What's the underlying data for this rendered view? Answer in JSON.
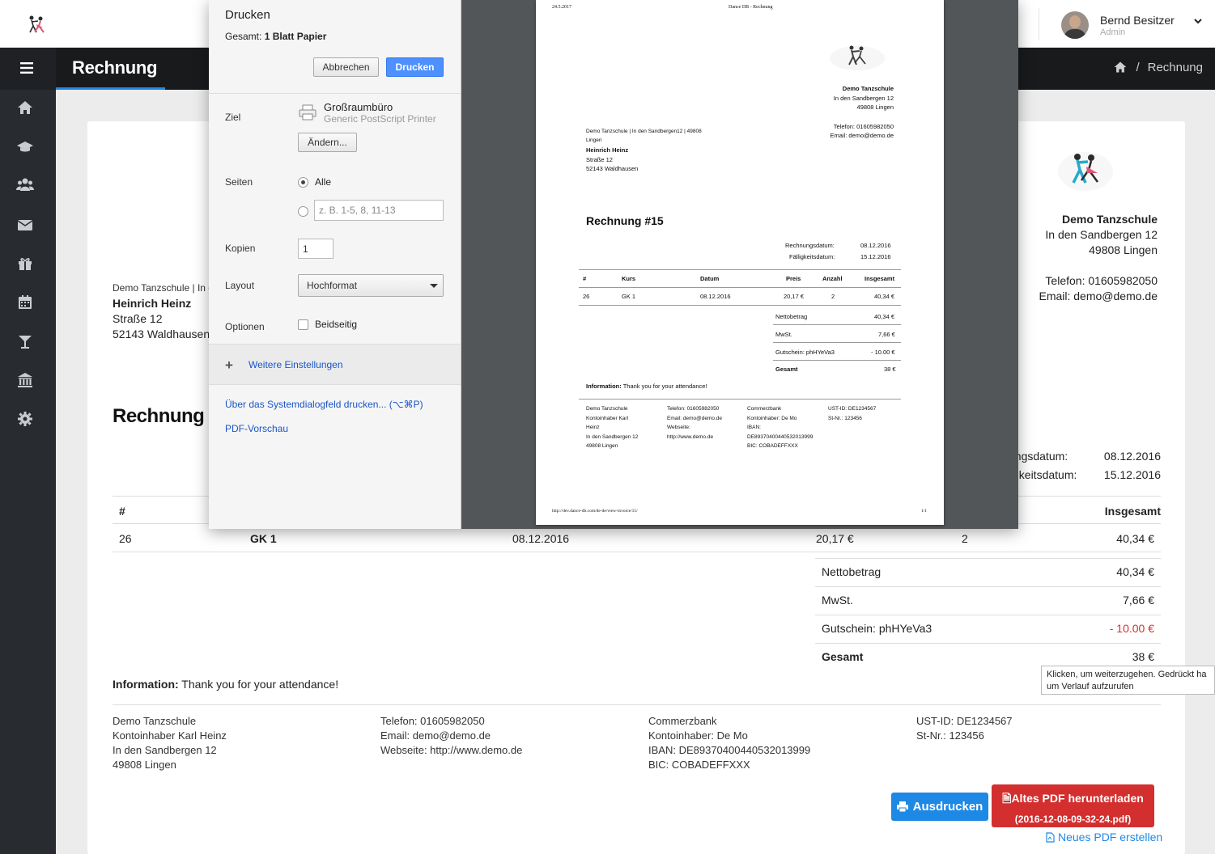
{
  "topbar": {
    "user_name": "Bernd Besitzer",
    "user_role": "Admin"
  },
  "header": {
    "title": "Rechnung",
    "breadcrumb": "Rechnung"
  },
  "sidebar": {
    "items": [
      "home-icon",
      "graduation-cap-icon",
      "users-icon",
      "envelope-icon",
      "gift-icon",
      "calendar-icon",
      "cocktail-icon",
      "bank-icon",
      "gear-icon"
    ]
  },
  "invoice": {
    "company": {
      "name": "Demo Tanzschule",
      "street": "In den Sandbergen 12",
      "city": "49808 Lingen",
      "phone": "Telefon: 01605982050",
      "email": "Email: demo@demo.de"
    },
    "sender_line": "Demo Tanzschule | In d",
    "recipient": {
      "name": "Heinrich Heinz",
      "street": "Straße 12",
      "city": "52143 Waldhausen"
    },
    "title": "Rechnung #",
    "invoice_date_label": "ungsdatum:",
    "invoice_date": "08.12.2016",
    "due_date_label": "gkeitsdatum:",
    "due_date": "15.12.2016",
    "table": {
      "col_num": "#",
      "col_total": "Insgesamt",
      "row": {
        "num": "26",
        "course": "GK 1",
        "date": "08.12.2016",
        "price": "20,17 €",
        "qty": "2",
        "total": "40,34 €"
      }
    },
    "summary": {
      "net_label": "Nettobetrag",
      "net": "40,34 €",
      "tax_label": "MwSt.",
      "tax": "7,66 €",
      "voucher_label": "Gutschein: phHYeVa3",
      "voucher": "- 10.00 €",
      "total_label": "Gesamt",
      "total": "38 €"
    },
    "info_label": "Information:",
    "info_text": " Thank you for your attendance!",
    "footer": {
      "col1": [
        "Demo Tanzschule",
        "Kontoinhaber Karl Heinz",
        "In den Sandbergen 12",
        "49808 Lingen"
      ],
      "col2": [
        "Telefon: 01605982050",
        "Email: demo@demo.de",
        "Webseite: http://www.demo.de"
      ],
      "col3": [
        "Commerzbank",
        "Kontoinhaber: De Mo",
        "IBAN: DE89370400440532013999",
        "BIC: COBADEFFXXX"
      ],
      "col4": [
        "UST-ID: DE1234567",
        "St-Nr.: 123456"
      ]
    },
    "print_button": "Ausdrucken",
    "old_pdf_button": "Altes PDF herunterladen",
    "old_pdf_file": "(2016-12-08-09-32-24.pdf)",
    "new_pdf_link": "Neues PDF erstellen"
  },
  "tooltip": {
    "line1": "Klicken, um weiterzugehen. Gedrückt ha",
    "line2": "um Verlauf aufzurufen"
  },
  "print_dialog": {
    "title": "Drucken",
    "total_label": "Gesamt: ",
    "total_value": "1 Blatt Papier",
    "cancel": "Abbrechen",
    "print": "Drucken",
    "dest_label": "Ziel",
    "printer_name": "Großraumbüro",
    "printer_type": "Generic PostScript Printer",
    "change": "Ändern...",
    "pages_label": "Seiten",
    "pages_all": "Alle",
    "pages_placeholder": "z. B. 1-5, 8, 11-13",
    "copies_label": "Kopien",
    "copies_value": "1",
    "layout_label": "Layout",
    "layout_value": "Hochformat",
    "options_label": "Optionen",
    "duplex": "Beidseitig",
    "more_settings": "Weitere Einstellungen",
    "system_dialog": "Über das Systemdialogfeld drucken... (⌥⌘P)",
    "pdf_preview": "PDF-Vorschau"
  },
  "preview": {
    "date": "24.5.2017",
    "header_title": "Dance DB - Rechnung",
    "company_name": "Demo Tanzschule",
    "company_street": "In den Sandbergen 12",
    "company_city": "49808 Lingen",
    "company_phone": "Telefon: 01605982050",
    "company_email": "Email: demo@demo.de",
    "sender_line1": "Demo Tanzschule | In den Sandbergen12 | 49808",
    "sender_line2": "Lingen",
    "recipient_name": "Heinrich Heinz",
    "recipient_street": "Straße 12",
    "recipient_city": "52143 Waldhausen",
    "title": "Rechnung #15",
    "invoice_date_label": "Rechnungsdatum:",
    "invoice_date": "08.12.2016",
    "due_date_label": "Fälligkeitsdatum:",
    "due_date": "15.12.2016",
    "th_num": "#",
    "th_course": "Kurs",
    "th_date": "Datum",
    "th_price": "Preis",
    "th_qty": "Anzahl",
    "th_total": "Insgesamt",
    "row_num": "26",
    "row_course": "GK 1",
    "row_date": "08.12.2016",
    "row_price": "20,17 €",
    "row_qty": "2",
    "row_total": "40,34 €",
    "net_label": "Nettobetrag",
    "net": "40,34 €",
    "tax_label": "MwSt.",
    "tax": "7,66 €",
    "voucher_label": "Gutschein: phHYeVa3",
    "voucher": "- 10.00 €",
    "total_label": "Gesamt",
    "total": "38 €",
    "info_label": "Information:",
    "info_text": " Thank you for your attendance!",
    "f1": [
      "Demo Tanzschule",
      "Kontoinhaber Karl",
      "Heinz",
      "In den Sandbergen 12",
      "49808 Lingen"
    ],
    "f2": [
      "Telefon: 01605982050",
      "Email: demo@demo.de",
      "Webseite:",
      "http://www.demo.de"
    ],
    "f3": [
      "Commerzbank",
      "Kontoinhaber: De Mo",
      "IBAN:",
      "DE89370400440532013999",
      "BIC: COBADEFFXXX"
    ],
    "f4": [
      "UST-ID: DE1234567",
      "St-Nr.: 123456"
    ],
    "url": "http://dev.dance-db.com/de-de/view-invoice/15/",
    "page_num": "1/1"
  },
  "colors": {
    "accent": "#1e88e5",
    "danger": "#d32f2f",
    "sidebar": "#282b30",
    "header": "#191a1c"
  }
}
